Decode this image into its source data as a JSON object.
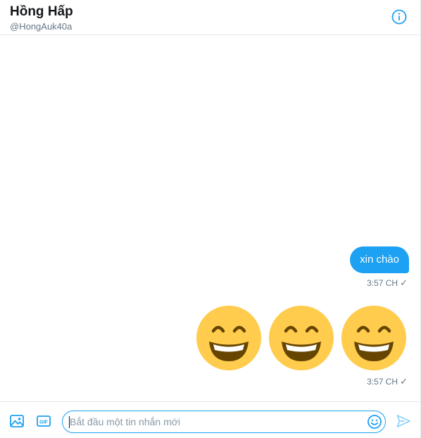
{
  "header": {
    "title": "Hồng Hấp",
    "handle": "@HongAuk40a",
    "info_icon": "info-circle-icon"
  },
  "messages": [
    {
      "type": "text",
      "text": "xin chào",
      "time": "3:57 CH",
      "status_icon": "check-icon"
    },
    {
      "type": "emoji",
      "emoji": [
        "😁",
        "😁",
        "😁"
      ],
      "emoji_name": "beaming-face-with-smiling-eyes",
      "time": "3:57 CH",
      "status_icon": "check-icon"
    }
  ],
  "composer": {
    "placeholder": "Bắt đầu một tin nhắn mới",
    "value": "",
    "media_icon": "image-icon",
    "gif_label": "GIF",
    "emoji_icon": "emoji-icon",
    "send_icon": "send-icon"
  },
  "colors": {
    "accent": "#1da1f2",
    "emoji_face": "#ffcc4d",
    "emoji_features": "#664500",
    "border": "#e1e8ed",
    "muted_text": "#657786"
  }
}
